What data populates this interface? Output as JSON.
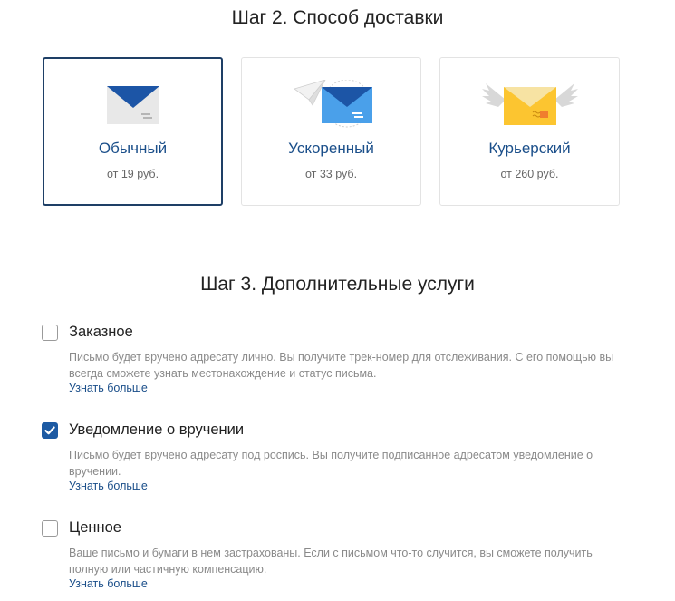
{
  "step2": {
    "title": "Шаг 2. Способ доставки",
    "options": [
      {
        "name": "Обычный",
        "price": "от 19 руб.",
        "icon": "envelope-icon",
        "selected": true
      },
      {
        "name": "Ускоренный",
        "price": "от 33 руб.",
        "icon": "paper-plane-envelope-icon",
        "selected": false
      },
      {
        "name": "Курьерский",
        "price": "от 260 руб.",
        "icon": "winged-envelope-icon",
        "selected": false
      }
    ]
  },
  "step3": {
    "title": "Шаг 3. Дополнительные услуги",
    "services": [
      {
        "label": "Заказное",
        "checked": false,
        "description": "Письмо будет вручено адресату лично. Вы получите трек-номер для отслеживания. С его помощью вы всегда сможете узнать местонахождение и статус письма.",
        "link": "Узнать больше"
      },
      {
        "label": "Уведомление о вручении",
        "checked": true,
        "description": "Письмо будет вручено адресату под роспись. Вы получите подписанное адресатом уведомление о вручении.",
        "link": "Узнать больше"
      },
      {
        "label": "Ценное",
        "checked": false,
        "description": "Ваше письмо и бумаги в нем застрахованы. Если с письмом что-то случится, вы сможете получить полную или частичную компенсацию.",
        "link": "Узнать больше"
      }
    ]
  },
  "colors": {
    "accent": "#1d5aa3",
    "selected_border": "#1e3f66",
    "link": "#1b4f8a",
    "muted_text": "#8a8a8a"
  }
}
